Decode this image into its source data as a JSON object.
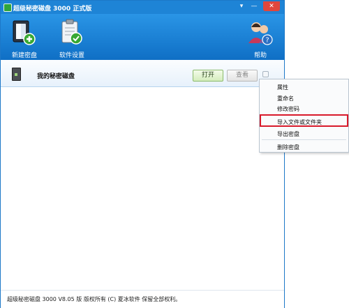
{
  "window": {
    "title": "超级秘密磁盘 3000 正式版",
    "controls": {
      "menu": "▾",
      "minimize": "—",
      "close": "✕"
    }
  },
  "toolbar": {
    "new_disk_label": "新建密盘",
    "settings_label": "软件设置",
    "help_label": "帮助"
  },
  "disk": {
    "name": "我的秘密磁盘",
    "open_label": "打开",
    "view_label": "查看"
  },
  "context_menu": {
    "items": [
      "属性",
      "重命名",
      "修改密码",
      "导入文件或文件夹",
      "导出密盘",
      "删除密盘"
    ],
    "highlighted_item": "导入文件或文件夹"
  },
  "status": {
    "text": "超级秘密磁盘 3000 V8.05 版   版权所有 (C) 夏冰软件  保留全部权利。"
  },
  "colors": {
    "titlebar": "#1e84d6",
    "toolbar": "#1473c9",
    "highlight_border": "#d8192a"
  }
}
